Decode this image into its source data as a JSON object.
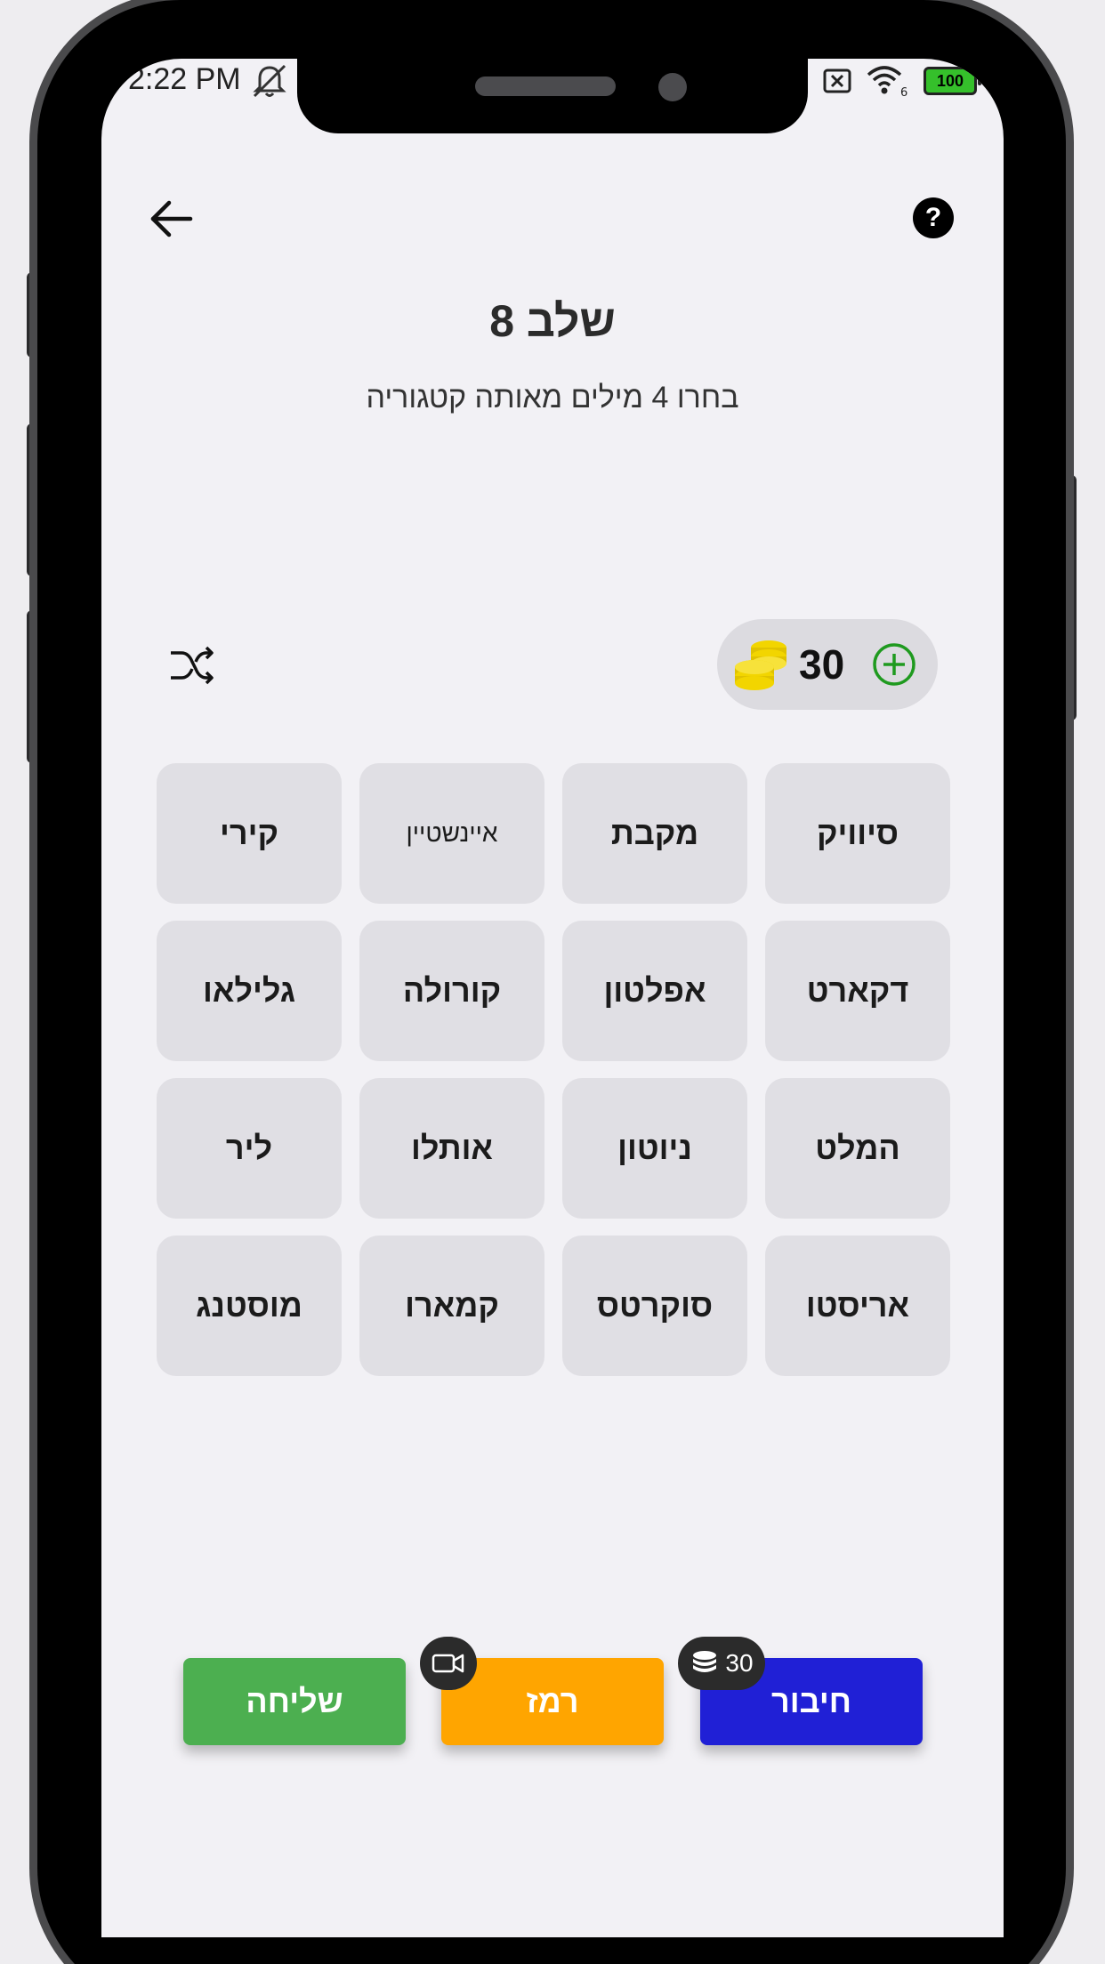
{
  "status_bar": {
    "time": "2:22 PM",
    "battery": "100",
    "wifi_label": "6"
  },
  "header": {
    "title": "שלב 8",
    "subtitle": "בחרו 4 מילים מאותה קטגוריה",
    "help_label": "?"
  },
  "coins": {
    "count": "30"
  },
  "tiles": [
    "סיוויק",
    "מקבת",
    "איינשטיין",
    "קירי",
    "דקארט",
    "אפלטון",
    "קורולה",
    "גלילאו",
    "המלט",
    "ניוטון",
    "אותלו",
    "ליר",
    "אריסטו",
    "סוקרטס",
    "קמארו",
    "מוסטנג"
  ],
  "actions": {
    "send_label": "שליחה",
    "hint_label": "רמז",
    "connect_label": "חיבור",
    "connect_cost": "30"
  },
  "colors": {
    "send": "#4caf50",
    "hint": "#ffa500",
    "connect": "#2020d6",
    "coin": "#f2d500",
    "add": "#1f9a1f"
  }
}
